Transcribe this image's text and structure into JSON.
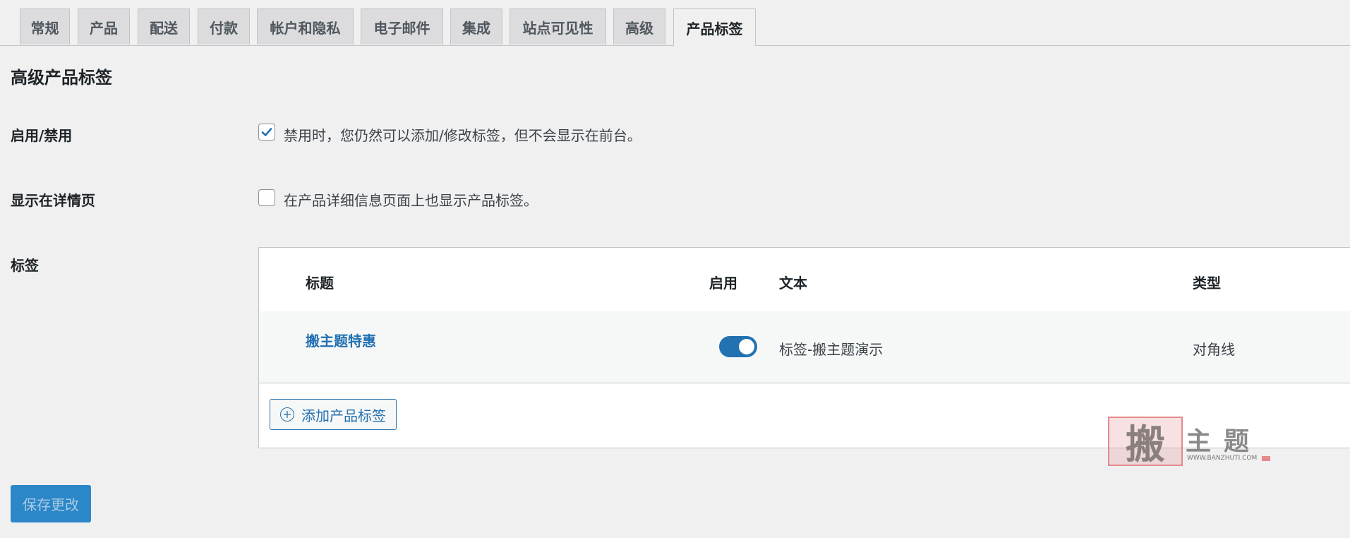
{
  "tabs": [
    {
      "label": "常规"
    },
    {
      "label": "产品"
    },
    {
      "label": "配送"
    },
    {
      "label": "付款"
    },
    {
      "label": "帐户和隐私"
    },
    {
      "label": "电子邮件"
    },
    {
      "label": "集成"
    },
    {
      "label": "站点可见性"
    },
    {
      "label": "高级"
    },
    {
      "label": "产品标签"
    }
  ],
  "active_tab": "产品标签",
  "section_title": "高级产品标签",
  "settings": {
    "enable": {
      "label": "启用/禁用",
      "checked": true,
      "description": "禁用时，您仍然可以添加/修改标签，但不会显示在前台。"
    },
    "detail": {
      "label": "显示在详情页",
      "checked": false,
      "description": "在产品详细信息页面上也显示产品标签。"
    },
    "labels": {
      "label": "标签"
    }
  },
  "table": {
    "headers": {
      "title": "标题",
      "enabled": "启用",
      "text": "文本",
      "type": "类型"
    },
    "rows": [
      {
        "title": "搬主题特惠",
        "enabled": true,
        "text": "标签-搬主题演示",
        "type": "对角线"
      }
    ],
    "add_button": "添加产品标签"
  },
  "save_button": "保存更改",
  "watermark": {
    "seal": "搬",
    "chars": "主题",
    "url": "WWW.BANZHUTI.COM"
  },
  "colors": {
    "accent": "#2271b1",
    "background": "#f0f0f1"
  }
}
